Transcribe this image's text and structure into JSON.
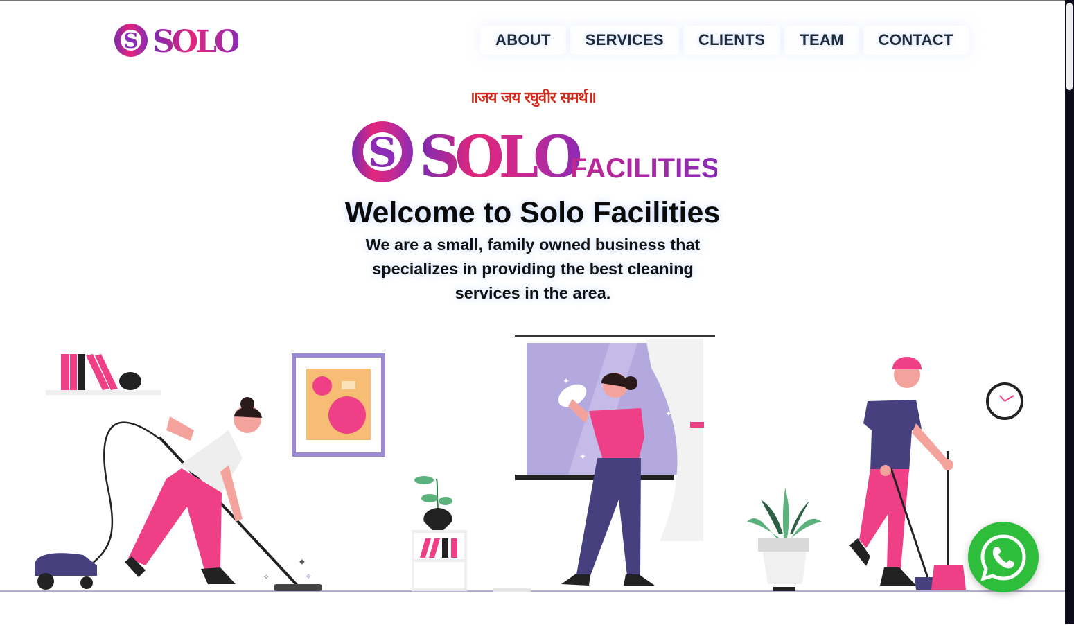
{
  "brand": {
    "logo_text": "SOLO",
    "logo_suffix": "FACILITIES",
    "gradient_start": "#8c2bb5",
    "gradient_end": "#e8287a"
  },
  "nav": {
    "items": [
      {
        "label": "ABOUT"
      },
      {
        "label": "SERVICES"
      },
      {
        "label": "CLIENTS"
      },
      {
        "label": "TEAM"
      },
      {
        "label": "CONTACT"
      }
    ]
  },
  "hero": {
    "blessing": "॥जय जय रघुवीर समर्थ॥",
    "title": "Welcome to Solo Facilities",
    "description": "We are a small, family owned business that specializes in providing the best cleaning services in the area."
  },
  "illustration": {
    "scene": "cleaning-crew",
    "accent_pink": "#ef3f86",
    "accent_purple": "#47407f",
    "accent_lavender": "#b3a9df"
  },
  "whatsapp": {
    "icon": "whatsapp-icon",
    "color": "#2fbe3c"
  }
}
